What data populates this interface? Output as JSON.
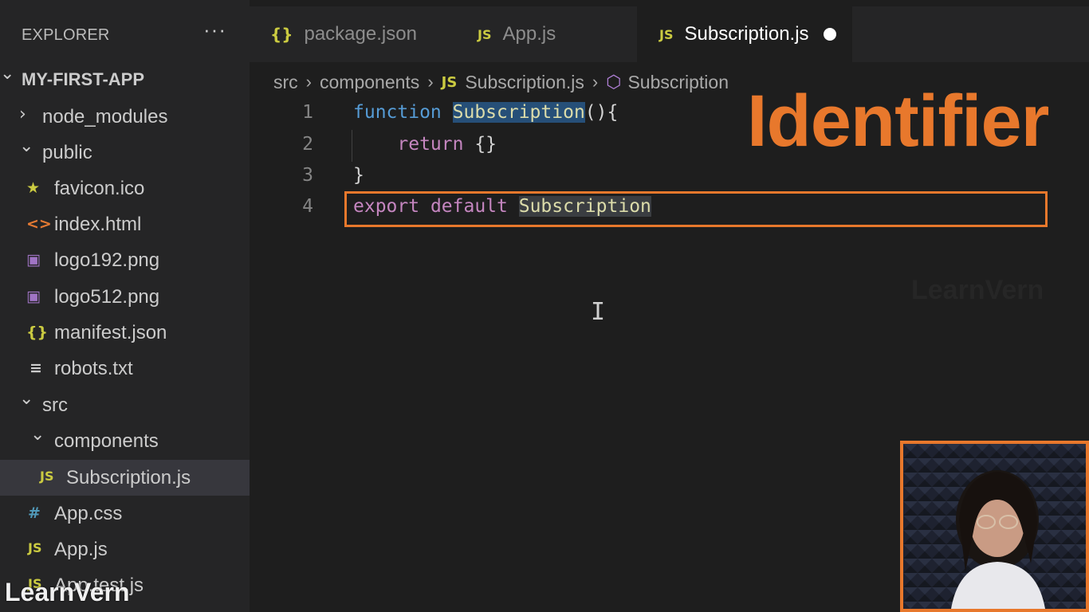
{
  "sidebar": {
    "title": "EXPLORER",
    "more": "···",
    "tree": [
      {
        "label": "MY-FIRST-APP",
        "type": "root-folder",
        "chevron": "open"
      },
      {
        "label": "node_modules",
        "type": "folder",
        "chevron": "closed"
      },
      {
        "label": "public",
        "type": "folder",
        "chevron": "open"
      },
      {
        "label": "favicon.ico",
        "type": "file",
        "icon": "★",
        "icon_name": "favicon-star-icon",
        "icon_color": "#cbcb41"
      },
      {
        "label": "index.html",
        "type": "file",
        "icon": "<>",
        "icon_name": "html-file-icon",
        "icon_color": "#e37933"
      },
      {
        "label": "logo192.png",
        "type": "file",
        "icon": "▣",
        "icon_name": "image-file-icon",
        "icon_color": "#a074c4"
      },
      {
        "label": "logo512.png",
        "type": "file",
        "icon": "▣",
        "icon_name": "image-file-icon",
        "icon_color": "#a074c4"
      },
      {
        "label": "manifest.json",
        "type": "file",
        "icon": "{}",
        "icon_name": "json-file-icon",
        "icon_color": "#cbcb41"
      },
      {
        "label": "robots.txt",
        "type": "file",
        "icon": "≡",
        "icon_name": "text-file-icon",
        "icon_color": "#cccccc"
      },
      {
        "label": "src",
        "type": "folder",
        "chevron": "open"
      },
      {
        "label": "components",
        "type": "folder",
        "chevron": "open"
      },
      {
        "label": "Subscription.js",
        "type": "file",
        "icon": "JS",
        "icon_name": "js-file-icon",
        "icon_color": "#cbcb41",
        "selected": true
      },
      {
        "label": "App.css",
        "type": "file",
        "icon": "#",
        "icon_name": "css-file-icon",
        "icon_color": "#519aba"
      },
      {
        "label": "App.js",
        "type": "file",
        "icon": "JS",
        "icon_name": "js-file-icon",
        "icon_color": "#cbcb41"
      },
      {
        "label": "App.test.js",
        "type": "file",
        "icon": "JS",
        "icon_name": "js-file-icon",
        "icon_color": "#cbcb41"
      }
    ]
  },
  "tabs": [
    {
      "label": "package.json",
      "icon": "{}",
      "icon_color": "#cbcb41",
      "active": false
    },
    {
      "label": "App.js",
      "icon": "JS",
      "icon_color": "#cbcb41",
      "active": false
    },
    {
      "label": "Subscription.js",
      "icon": "JS",
      "icon_color": "#cbcb41",
      "active": true,
      "unsaved": true
    }
  ],
  "breadcrumb": {
    "parts": [
      "src",
      "components",
      "Subscription.js",
      "Subscription"
    ],
    "separator": ">"
  },
  "editor": {
    "lines": [
      {
        "num": "1",
        "tokens": [
          {
            "t": "function ",
            "c": "kw-blue"
          },
          {
            "t": "Subscription",
            "c": "hl-sel"
          },
          {
            "t": "(){",
            "c": ""
          }
        ]
      },
      {
        "num": "2",
        "tokens": [
          {
            "t": "    return ",
            "c": "kw-pink"
          },
          {
            "t": "{}",
            "c": ""
          }
        ]
      },
      {
        "num": "3",
        "tokens": [
          {
            "t": "}",
            "c": ""
          }
        ]
      },
      {
        "num": "4",
        "tokens": [
          {
            "t": "export ",
            "c": "kw-pink"
          },
          {
            "t": "default ",
            "c": "kw-pink"
          },
          {
            "t": "Subscription",
            "c": "hl-word"
          }
        ]
      }
    ]
  },
  "overlay": {
    "title": "Identifier",
    "watermark_right": "LearnVern",
    "watermark_left": "LearnVern",
    "accent_color": "#e8782c"
  }
}
